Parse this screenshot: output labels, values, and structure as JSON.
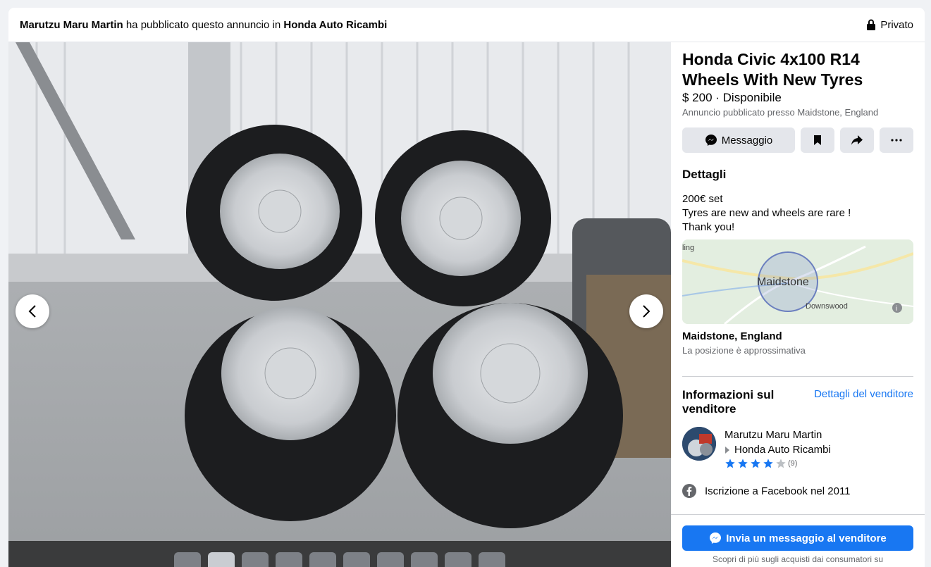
{
  "header": {
    "seller": "Marutzu Maru Martin",
    "text_middle": "ha pubblicato questo annuncio in",
    "group": "Honda Auto Ricambi",
    "privacy": "Privato"
  },
  "listing": {
    "title": "Honda Civic 4x100 R14 Wheels With New Tyres",
    "price_status": "$ 200 · Disponibile",
    "posted_location": "Annuncio pubblicato presso Maidstone, England"
  },
  "actions": {
    "message_label": "Messaggio"
  },
  "details": {
    "heading": "Dettagli",
    "lines": [
      "200€ set",
      "Tyres are new and wheels are rare !",
      "Thank you!"
    ]
  },
  "map": {
    "label_city": "Maidstone",
    "label_area": "Downswood",
    "label_edge": "ling",
    "city": "Maidstone, England",
    "note": "La posizione è approssimativa"
  },
  "seller": {
    "heading": "Informazioni sul venditore",
    "details_link": "Dettagli del venditore",
    "name": "Marutzu Maru Martin",
    "group": "Honda Auto Ricambi",
    "rating_count": "(9)",
    "rating": 4,
    "joined": "Iscrizione a Facebook nel 2011"
  },
  "footer": {
    "send_label": "Invia un messaggio al venditore",
    "note": "Scopri di più sugli acquisti dai consumatori su"
  },
  "colors": {
    "accent": "#1877f2",
    "star": "#1877f2"
  }
}
